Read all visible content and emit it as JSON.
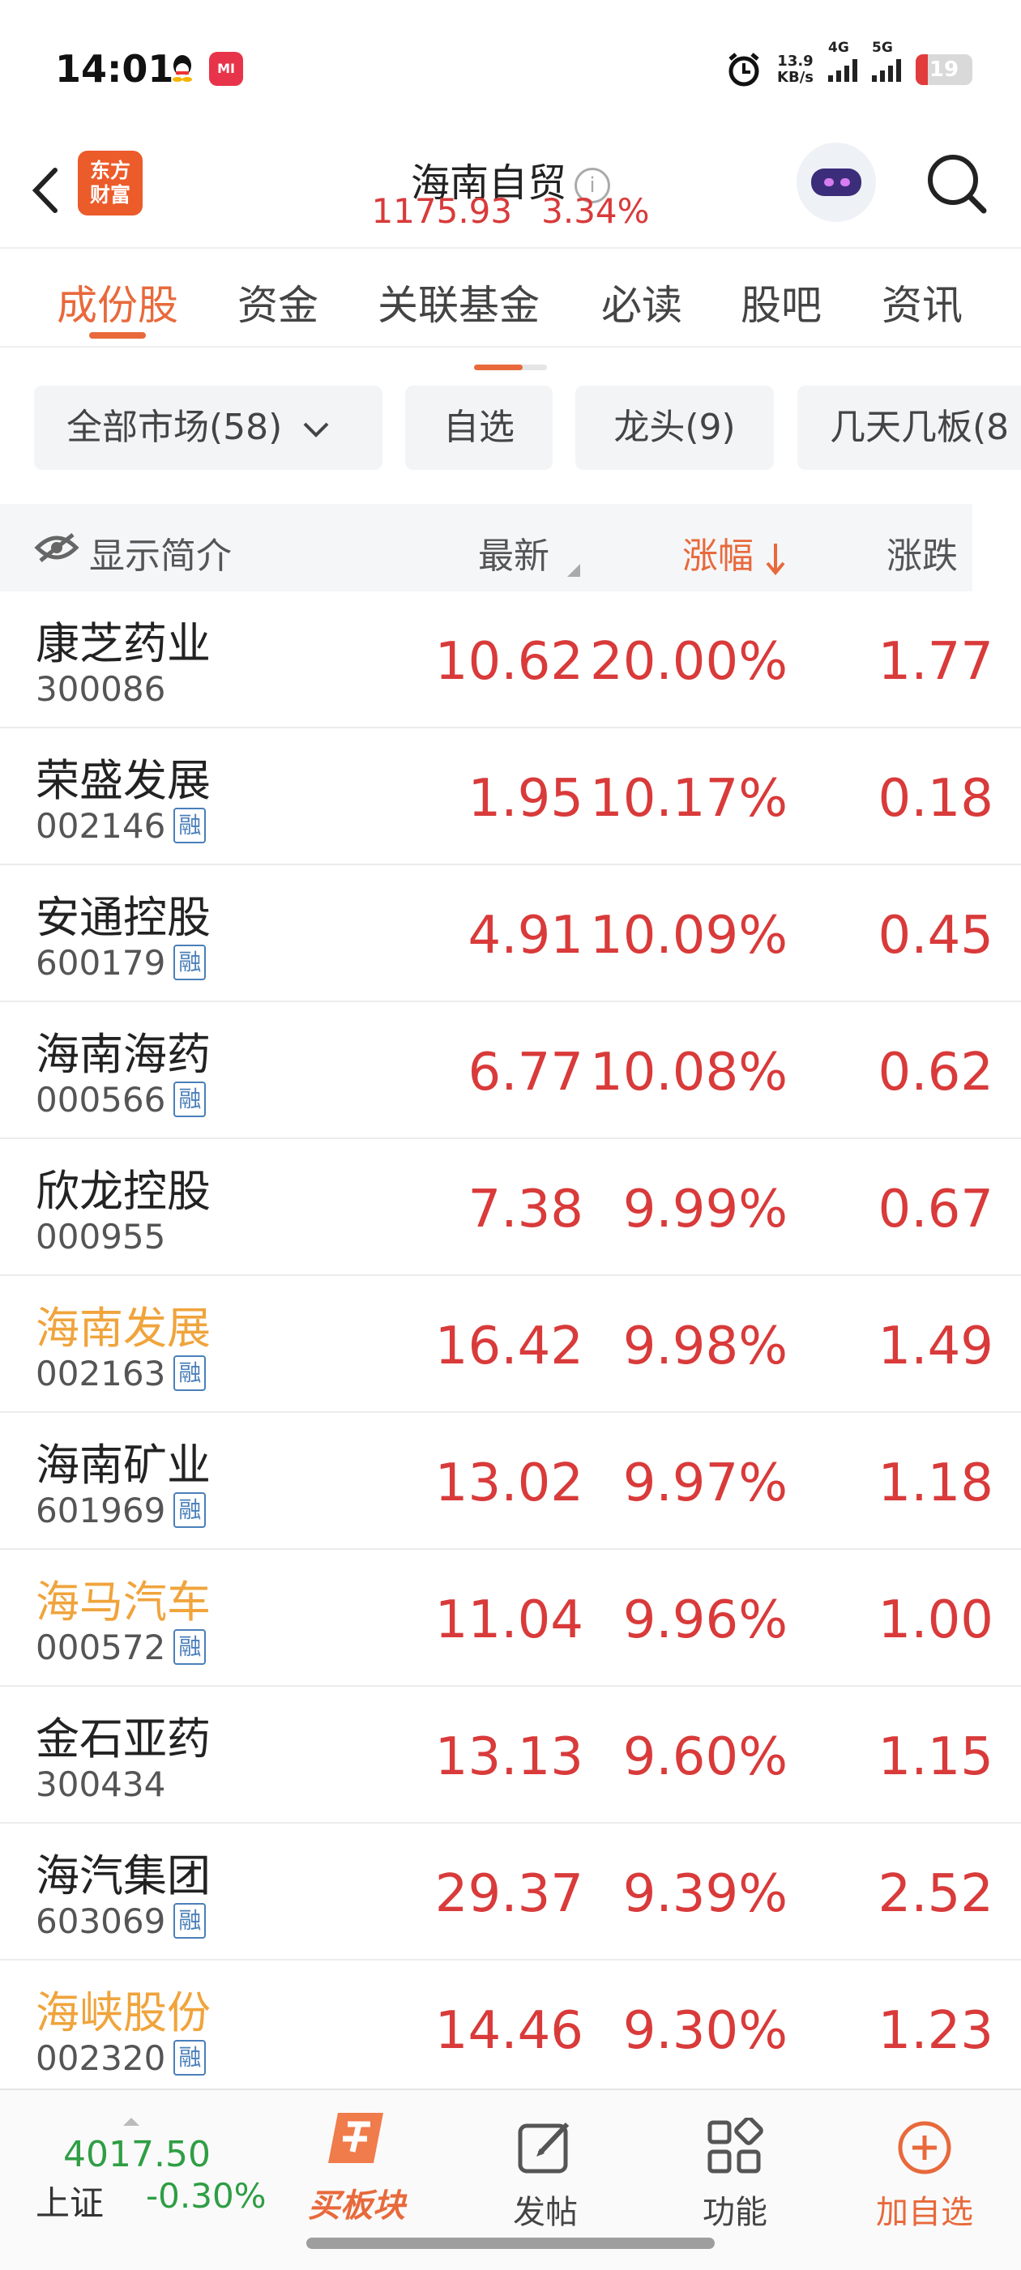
{
  "status_bar": {
    "time": "14:01",
    "speed_value": "13.9",
    "speed_unit": "KB/s",
    "network1": "4G",
    "network2": "5G",
    "battery": "19",
    "battery_level": 0.19,
    "app_badge": "MI"
  },
  "header": {
    "logo_line1": "东方",
    "logo_line2": "财富",
    "title": "海南自贸",
    "info_icon": "i",
    "index_value": "1175.93",
    "index_change": "3.34%"
  },
  "tabs": [
    {
      "label": "成份股",
      "active": true
    },
    {
      "label": "资金",
      "active": false
    },
    {
      "label": "关联基金",
      "active": false
    },
    {
      "label": "必读",
      "active": false
    },
    {
      "label": "股吧",
      "active": false
    },
    {
      "label": "资讯",
      "active": false
    }
  ],
  "filters": [
    {
      "label": "全部市场(58)"
    },
    {
      "label": "自选"
    },
    {
      "label": "龙头(9)"
    },
    {
      "label": "几天几板(8"
    }
  ],
  "table_header": {
    "show_intro": "显示简介",
    "latest": "最新",
    "change_pct": "涨幅",
    "change": "涨跌"
  },
  "rows": [
    {
      "name": "康芝药业",
      "code": "300086",
      "margin": "",
      "price": "10.62",
      "pct": "20.00%",
      "chg": "1.77",
      "highlight": false
    },
    {
      "name": "荣盛发展",
      "code": "002146",
      "margin": "融",
      "price": "1.95",
      "pct": "10.17%",
      "chg": "0.18",
      "highlight": false
    },
    {
      "name": "安通控股",
      "code": "600179",
      "margin": "融",
      "price": "4.91",
      "pct": "10.09%",
      "chg": "0.45",
      "highlight": false
    },
    {
      "name": "海南海药",
      "code": "000566",
      "margin": "融",
      "price": "6.77",
      "pct": "10.08%",
      "chg": "0.62",
      "highlight": false
    },
    {
      "name": "欣龙控股",
      "code": "000955",
      "margin": "",
      "price": "7.38",
      "pct": "9.99%",
      "chg": "0.67",
      "highlight": false
    },
    {
      "name": "海南发展",
      "code": "002163",
      "margin": "融",
      "price": "16.42",
      "pct": "9.98%",
      "chg": "1.49",
      "highlight": true
    },
    {
      "name": "海南矿业",
      "code": "601969",
      "margin": "融",
      "price": "13.02",
      "pct": "9.97%",
      "chg": "1.18",
      "highlight": false
    },
    {
      "name": "海马汽车",
      "code": "000572",
      "margin": "融",
      "price": "11.04",
      "pct": "9.96%",
      "chg": "1.00",
      "highlight": true
    },
    {
      "name": "金石亚药",
      "code": "300434",
      "margin": "",
      "price": "13.13",
      "pct": "9.60%",
      "chg": "1.15",
      "highlight": false
    },
    {
      "name": "海汽集团",
      "code": "603069",
      "margin": "融",
      "price": "29.37",
      "pct": "9.39%",
      "chg": "2.52",
      "highlight": false
    },
    {
      "name": "海峡股份",
      "code": "002320",
      "margin": "融",
      "price": "14.46",
      "pct": "9.30%",
      "chg": "1.23",
      "highlight": true
    }
  ],
  "bottom_bar": {
    "index_value": "4017.50",
    "index_name": "上证",
    "index_change": "-0.30%",
    "buy_block": "买板块",
    "post": "发帖",
    "functions": "功能",
    "add_watch": "加自选"
  },
  "colors": {
    "accent": "#e8693b",
    "up": "#d93a3a",
    "down": "#2f9e44",
    "highlight_name": "#f0a43c"
  }
}
